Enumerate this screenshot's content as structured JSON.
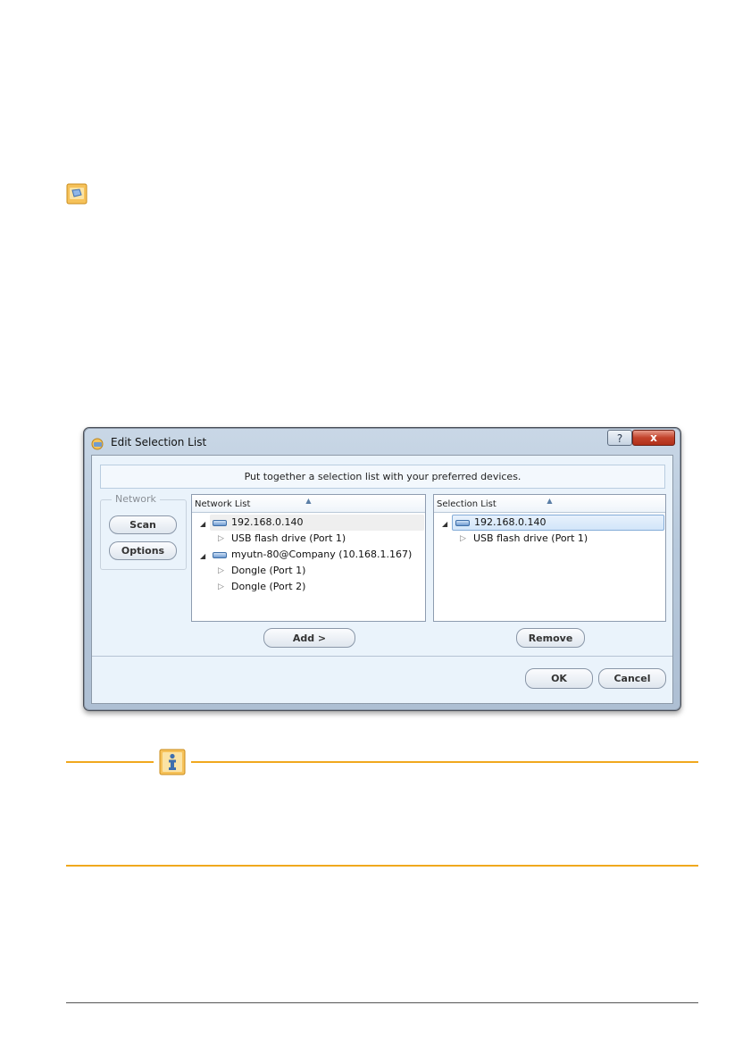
{
  "dialog": {
    "title": "Edit Selection List",
    "help_label": "?",
    "close_label": "x",
    "hint_text": "Put together a selection list with your preferred devices.",
    "network_group": {
      "label": "Network",
      "scan_label": "Scan",
      "options_label": "Options"
    },
    "network_list": {
      "header": "Network List",
      "items": [
        {
          "label": "192.168.0.140",
          "level": 0,
          "expanded": true
        },
        {
          "label": "USB flash drive (Port 1)",
          "level": 1
        },
        {
          "label": "myutn-80@Company (10.168.1.167)",
          "level": 0,
          "expanded": true
        },
        {
          "label": "Dongle (Port 1)",
          "level": 1
        },
        {
          "label": "Dongle (Port 2)",
          "level": 1
        }
      ]
    },
    "selection_list": {
      "header": "Selection List",
      "items": [
        {
          "label": "192.168.0.140",
          "level": 0,
          "expanded": true
        },
        {
          "label": "USB flash drive (Port 1)",
          "level": 1
        }
      ]
    },
    "add_label": "Add >",
    "remove_label": "Remove",
    "ok_label": "OK",
    "cancel_label": "Cancel"
  },
  "colors": {
    "note_rule": "#f0a81e",
    "selection_highlight": "#d2e5f9"
  },
  "icons": {
    "page_note": "sticky-note-icon",
    "info": "info-icon",
    "device": "network-device-icon"
  }
}
